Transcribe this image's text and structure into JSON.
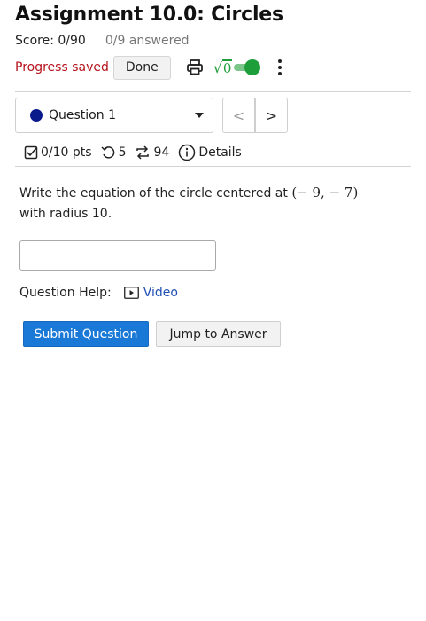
{
  "header": {
    "title": "Assignment 10.0: Circles",
    "score": "Score: 0/90",
    "answered": "0/9 answered",
    "progress_status": "Progress saved",
    "done_label": "Done",
    "math_toggle_symbol": "√",
    "math_toggle_radicand": "0",
    "math_toggle_on": true
  },
  "question_nav": {
    "selected": "Question 1",
    "prev_label": "<",
    "next_label": ">"
  },
  "meta": {
    "points": "0/10 pts",
    "retries": "5",
    "attempts": "94",
    "details_label": "Details"
  },
  "question": {
    "text_before": "Write the equation of the circle centered at ",
    "center": "(− 9,  − 7)",
    "text_after": "with radius 10.",
    "answer_value": "",
    "answer_placeholder": ""
  },
  "help": {
    "label": "Question Help:",
    "video_label": "Video"
  },
  "actions": {
    "submit_label": "Submit Question",
    "jump_label": "Jump to Answer"
  },
  "colors": {
    "progress_red": "#b5121b",
    "toggle_green": "#1e9e3a",
    "submit_blue": "#1a78d6",
    "link_blue": "#1f4fb5",
    "question_dot": "#0b1a8a"
  }
}
